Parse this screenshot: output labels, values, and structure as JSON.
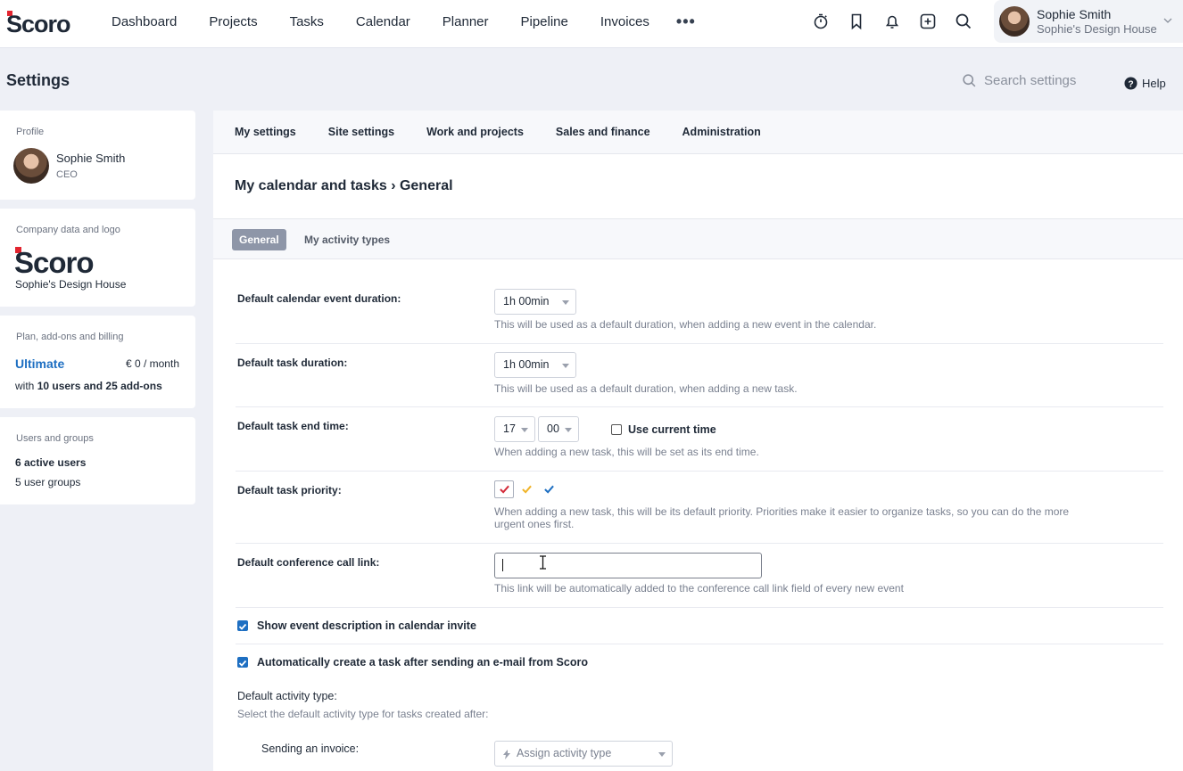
{
  "nav": {
    "items": [
      "Dashboard",
      "Projects",
      "Tasks",
      "Calendar",
      "Planner",
      "Pipeline",
      "Invoices"
    ],
    "more": "•••"
  },
  "user": {
    "name": "Sophie Smith",
    "org": "Sophie's Design House"
  },
  "page": {
    "title": "Settings",
    "search_placeholder": "Search settings",
    "help": "Help"
  },
  "sidebar": {
    "profile": {
      "label": "Profile",
      "name": "Sophie Smith",
      "role": "CEO"
    },
    "company": {
      "label": "Company data and logo",
      "name": "Sophie's Design House",
      "logo_text": "Scoro"
    },
    "plan": {
      "label": "Plan, add-ons and billing",
      "name": "Ultimate",
      "price": "€ 0 / month",
      "desc_prefix": "with ",
      "desc_bold": "10 users and 25 add-ons"
    },
    "users": {
      "label": "Users and groups",
      "active": "6 active users",
      "groups": "5 user groups"
    }
  },
  "tabs": [
    "My settings",
    "Site settings",
    "Work and projects",
    "Sales and finance",
    "Administration"
  ],
  "breadcrumb": "My calendar and tasks › General",
  "subtabs": {
    "active": "General",
    "other": "My activity types"
  },
  "form": {
    "event_duration": {
      "label": "Default calendar event duration:",
      "value": "1h 00min",
      "hint": "This will be used as a default duration, when adding a new event in the calendar."
    },
    "task_duration": {
      "label": "Default task duration:",
      "value": "1h 00min",
      "hint": "This will be used as a default duration, when adding a new task."
    },
    "task_end_time": {
      "label": "Default task end time:",
      "hour": "17",
      "minute": "00",
      "use_current": "Use current time",
      "hint": "When adding a new task, this will be set as its end time."
    },
    "task_priority": {
      "label": "Default task priority:",
      "hint_line1": "When adding a new task, this will be its default priority. Priorities make it easier to organize tasks, so you can do the more",
      "hint_line2": "urgent ones first."
    },
    "conference_link": {
      "label": "Default conference call link:",
      "value": "",
      "hint": "This link will be automatically added to the conference call link field of every new event"
    },
    "show_description": {
      "label": "Show event description in calendar invite",
      "checked": true
    },
    "auto_task": {
      "label": "Automatically create a task after sending an e-mail from Scoro",
      "checked": true
    },
    "activity_type": {
      "label": "Default activity type:",
      "hint": "Select the default activity type for tasks created after:"
    },
    "sending_invoice": {
      "label": "Sending an invoice:",
      "placeholder": "Assign activity type"
    }
  },
  "colors": {
    "accent": "#1e6fc2",
    "brand_red": "#e2242f",
    "priority_high": "#d32b3a",
    "priority_medium": "#f0b429",
    "priority_low": "#1e6fc2"
  }
}
